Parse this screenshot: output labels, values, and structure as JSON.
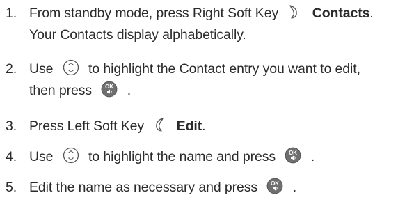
{
  "steps": [
    {
      "number": "1.",
      "line1_before": "From standby mode, press Right Soft Key",
      "line1_icon": "right-soft-key-icon",
      "line1_bold": "Contacts",
      "line1_after": ".",
      "line2": "Your Contacts display alphabetically."
    },
    {
      "number": "2.",
      "line1_before": "Use",
      "line1_icon": "navigation-key-icon",
      "line1_after": "to highlight the Contact entry you want to edit,",
      "line2_before": "then press",
      "line2_icon": "ok-key-icon",
      "line2_after": "."
    },
    {
      "number": "3.",
      "line1_before": "Press Left Soft Key",
      "line1_icon": "left-soft-key-icon",
      "line1_bold": "Edit",
      "line1_after": "."
    },
    {
      "number": "4.",
      "line1_before": "Use",
      "line1_icon": "navigation-key-icon",
      "line1_middle": "to highlight the name and press",
      "line1_icon2": "ok-key-icon",
      "line1_after": "."
    },
    {
      "number": "5.",
      "line1_before": "Edit the name as necessary and press",
      "line1_icon": "ok-key-icon",
      "line1_after": "."
    }
  ],
  "colors": {
    "text": "#2b2b2b",
    "icon_stroke": "#555555",
    "ok_key_fill": "#6f6f6f"
  }
}
